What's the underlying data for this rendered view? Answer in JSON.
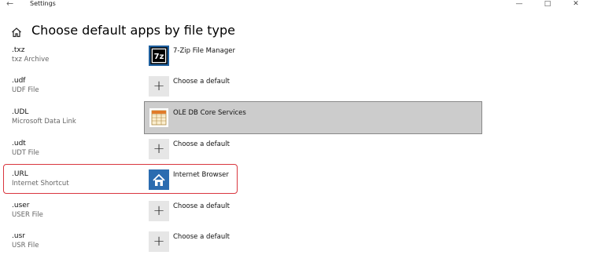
{
  "window": {
    "back_glyph": "←",
    "title": "Settings",
    "minimize_glyph": "—",
    "maximize_glyph": "□",
    "close_glyph": "✕"
  },
  "page": {
    "title": "Choose default apps by file type"
  },
  "rows": [
    {
      "ext": ".txz",
      "desc": "txz Archive",
      "app": "7-Zip File Manager",
      "icon": "7zip-icon"
    },
    {
      "ext": ".udf",
      "desc": "UDF File",
      "app": "Choose a default",
      "icon": "plus-icon"
    },
    {
      "ext": ".UDL",
      "desc": "Microsoft Data Link",
      "app": "OLE DB Core Services",
      "icon": "ole-db-icon"
    },
    {
      "ext": ".udt",
      "desc": "UDT File",
      "app": "Choose a default",
      "icon": "plus-icon"
    },
    {
      "ext": ".URL",
      "desc": "Internet Shortcut",
      "app": "Internet Browser",
      "icon": "internet-browser-icon"
    },
    {
      "ext": ".user",
      "desc": "USER File",
      "app": "Choose a default",
      "icon": "plus-icon"
    },
    {
      "ext": ".usr",
      "desc": "USR File",
      "app": "Choose a default",
      "icon": "plus-icon"
    }
  ],
  "colors": {
    "accent": "#0063b1",
    "highlight": "#d9363e",
    "selected_bg": "#cccccc"
  }
}
